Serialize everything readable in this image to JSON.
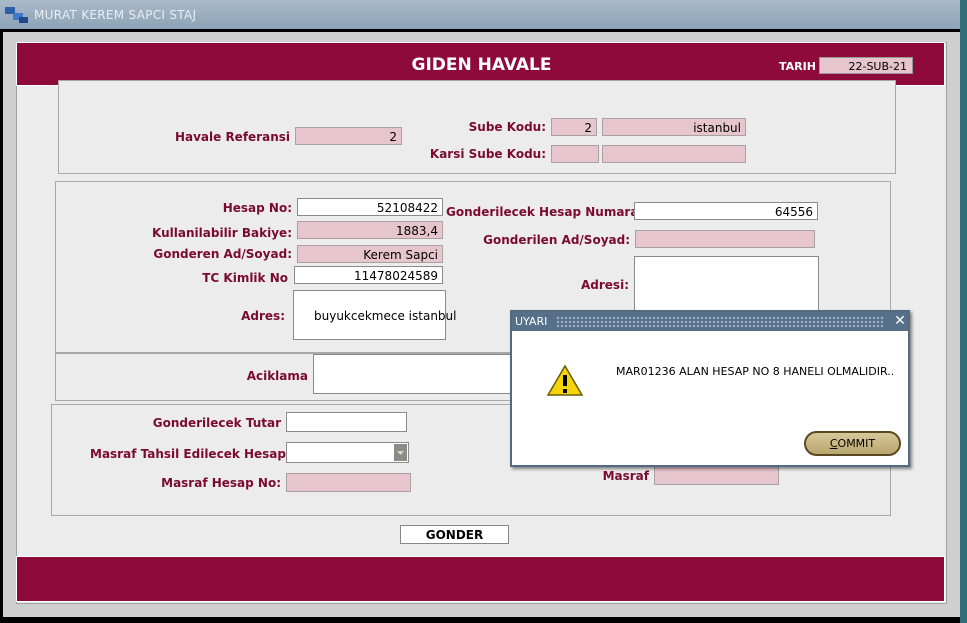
{
  "window": {
    "title": "MURAT KEREM SAPCI STAJ"
  },
  "header": {
    "title": "GIDEN HAVALE",
    "tarih_label": "TARIH",
    "tarih_value": "22-SUB-21"
  },
  "top_panel": {
    "havale_referansi_label": "Havale Referansi",
    "havale_referansi_value": "2",
    "sube_kodu_label": "Sube Kodu:",
    "sube_kodu_value": "2",
    "sube_adi_value": "istanbul",
    "karsi_sube_kodu_label": "Karsi Sube Kodu:",
    "karsi_sube_kodu_value": "",
    "karsi_sube_adi_value": ""
  },
  "sender": {
    "hesap_no_label": "Hesap No:",
    "hesap_no_value": "52108422",
    "bakiye_label": "Kullanilabilir Bakiye:",
    "bakiye_value": "1883,4",
    "ad_soyad_label": "Gonderen Ad/Soyad:",
    "ad_soyad_value": "Kerem Sapci",
    "tc_label": "TC Kimlik No",
    "tc_value": "11478024589",
    "adres_label": "Adres:",
    "adres_value": "buyukcekmece istanbul"
  },
  "receiver": {
    "hesap_label": "Gonderilecek Hesap Numarasi",
    "hesap_value": "64556",
    "ad_soyad_label": "Gonderilen Ad/Soyad:",
    "ad_soyad_value": "",
    "adresi_label": "Adresi:",
    "adresi_value": ""
  },
  "aciklama": {
    "label": "Aciklama",
    "value": ""
  },
  "amount": {
    "tutar_label": "Gonderilecek Tutar",
    "tutar_value": "",
    "masraf_tahsil_label": "Masraf Tahsil Edilecek Hesap",
    "masraf_tahsil_value": "",
    "masraf_hesap_label": "Masraf Hesap No:",
    "masraf_hesap_value": "",
    "masraf_label": "Masraf",
    "masraf_value": ""
  },
  "actions": {
    "gonder_label": "GONDER"
  },
  "dialog": {
    "title": "UYARI",
    "message": "MAR01236 ALAN HESAP NO 8 HANELI OLMALIDIR..",
    "commit_first": "C",
    "commit_rest": "OMMIT",
    "close_glyph": "✕"
  },
  "colors": {
    "brand": "#8e0a3b",
    "label": "#7b0a31",
    "readonly_field": "#e6c6cc",
    "dialog_title": "#57708a"
  }
}
